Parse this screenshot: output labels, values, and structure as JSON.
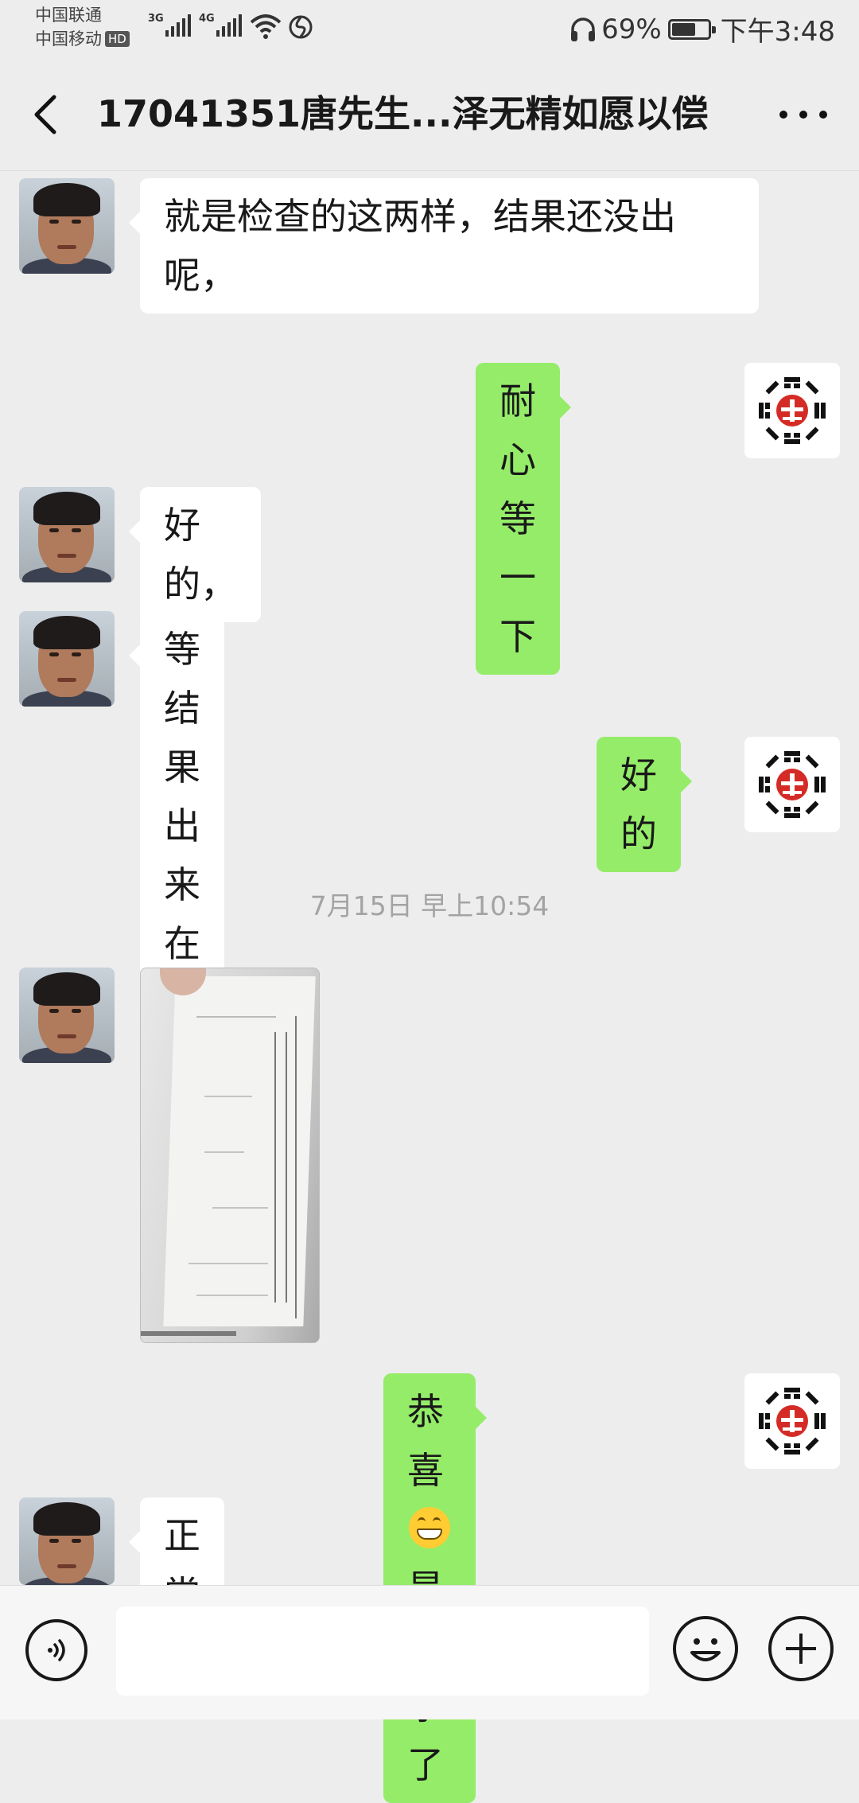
{
  "status_bar": {
    "carrier_1": "中国联通",
    "carrier_2": "中国移动",
    "hd_badge": "HD",
    "network_1": "3G",
    "network_2": "4G",
    "battery": "69%",
    "battery_level": 0.69,
    "time": "下午3:48"
  },
  "header": {
    "title": "17041351唐先生...泽无精如愿以偿"
  },
  "messages": [
    {
      "side": "left",
      "sender": "user",
      "text": "就是检查的这两样，结果还没出呢，"
    },
    {
      "side": "right",
      "sender": "agent",
      "text": "耐心等一下"
    },
    {
      "side": "left",
      "sender": "user",
      "text": "好的，"
    },
    {
      "side": "left",
      "sender": "user",
      "text": "等结果出来在和你说"
    },
    {
      "side": "right",
      "sender": "agent",
      "text": "好的"
    },
    {
      "side": "left",
      "sender": "user",
      "type": "image",
      "alt": "hospital report photo"
    },
    {
      "side": "right",
      "sender": "agent",
      "text_before": "恭喜",
      "emoji": "grin-emoji",
      "text_after": "是怀孕了"
    },
    {
      "side": "left",
      "sender": "user",
      "text": "正常吗"
    }
  ],
  "timestamp": "7月15日 早上10:54",
  "input_bar": {
    "placeholder": "",
    "value": ""
  },
  "colors": {
    "background": "#ededed",
    "left_bubble": "#ffffff",
    "right_bubble": "#95ec69",
    "agent_logo_red": "#d42b26"
  }
}
